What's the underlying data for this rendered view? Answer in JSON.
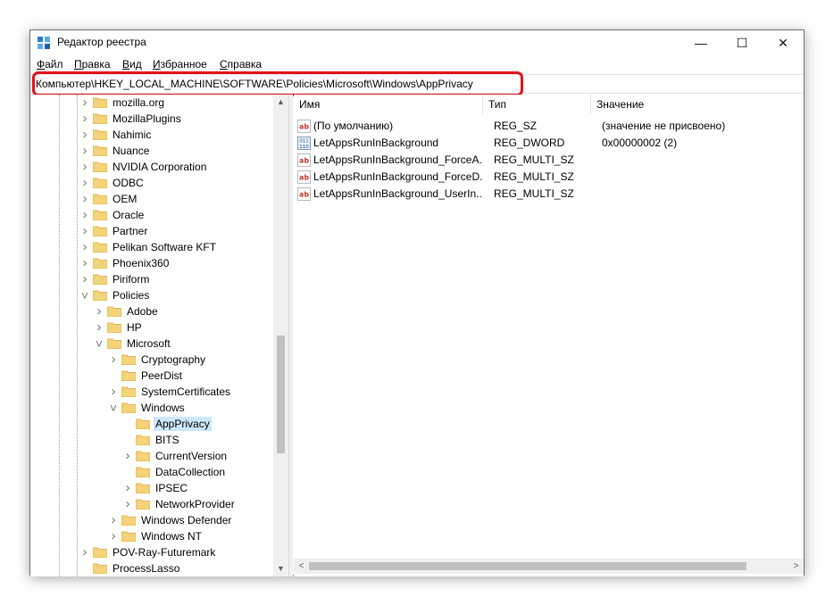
{
  "window": {
    "title": "Редактор реестра",
    "buttons": {
      "minimize": "—",
      "maximize": "☐",
      "close": "✕"
    }
  },
  "menu": {
    "items": [
      {
        "first": "Ф",
        "rest": "айл"
      },
      {
        "first": "П",
        "rest": "равка"
      },
      {
        "first": "В",
        "rest": "ид"
      },
      {
        "first": "И",
        "rest": "збранное"
      },
      {
        "first": "С",
        "rest": "правка"
      }
    ]
  },
  "address": {
    "path": "Компьютер\\HKEY_LOCAL_MACHINE\\SOFTWARE\\Policies\\Microsoft\\Windows\\AppPrivacy",
    "highlight_color": "#e2121b"
  },
  "tree": {
    "items": [
      {
        "label": "mozilla.org",
        "expander": "collapsed"
      },
      {
        "label": "MozillaPlugins",
        "expander": "collapsed"
      },
      {
        "label": "Nahimic",
        "expander": "collapsed"
      },
      {
        "label": "Nuance",
        "expander": "collapsed"
      },
      {
        "label": "NVIDIA Corporation",
        "expander": "collapsed"
      },
      {
        "label": "ODBC",
        "expander": "collapsed"
      },
      {
        "label": "OEM",
        "expander": "collapsed"
      },
      {
        "label": "Oracle",
        "expander": "collapsed"
      },
      {
        "label": "Partner",
        "expander": "collapsed"
      },
      {
        "label": "Pelikan Software KFT",
        "expander": "collapsed"
      },
      {
        "label": "Phoenix360",
        "expander": "collapsed"
      },
      {
        "label": "Piriform",
        "expander": "collapsed"
      },
      {
        "label": "Policies",
        "expander": "expanded"
      },
      {
        "label": "Adobe",
        "expander": "collapsed"
      },
      {
        "label": "HP",
        "expander": "collapsed"
      },
      {
        "label": "Microsoft",
        "expander": "expanded"
      },
      {
        "label": "Cryptography",
        "expander": "collapsed"
      },
      {
        "label": "PeerDist",
        "expander": "none"
      },
      {
        "label": "SystemCertificates",
        "expander": "collapsed"
      },
      {
        "label": "Windows",
        "expander": "expanded"
      },
      {
        "label": "AppPrivacy",
        "expander": "none",
        "selected": true
      },
      {
        "label": "BITS",
        "expander": "none"
      },
      {
        "label": "CurrentVersion",
        "expander": "collapsed"
      },
      {
        "label": "DataCollection",
        "expander": "none"
      },
      {
        "label": "IPSEC",
        "expander": "collapsed"
      },
      {
        "label": "NetworkProvider",
        "expander": "collapsed"
      },
      {
        "label": "Windows Defender",
        "expander": "collapsed"
      },
      {
        "label": "Windows NT",
        "expander": "collapsed"
      },
      {
        "label": "POV-Ray-Futuremark",
        "expander": "collapsed"
      },
      {
        "label": "ProcessLasso",
        "expander": "none"
      }
    ],
    "selected_bg": "#cce8ff",
    "folder_color": "#f5d37a"
  },
  "list": {
    "columns": {
      "name": "Имя",
      "type": "Тип",
      "data": "Значение"
    },
    "rows": [
      {
        "icon": "string-value-icon",
        "icon_text": "ab",
        "name": "(По умолчанию)",
        "type": "REG_SZ",
        "data": "(значение не присвоено)"
      },
      {
        "icon": "dword-value-icon",
        "icon_text": "011",
        "name": "LetAppsRunInBackground",
        "type": "REG_DWORD",
        "data": "0x00000002 (2)"
      },
      {
        "icon": "string-value-icon",
        "icon_text": "ab",
        "name": "LetAppsRunInBackground_ForceA...",
        "type": "REG_MULTI_SZ",
        "data": ""
      },
      {
        "icon": "string-value-icon",
        "icon_text": "ab",
        "name": "LetAppsRunInBackground_ForceD...",
        "type": "REG_MULTI_SZ",
        "data": ""
      },
      {
        "icon": "string-value-icon",
        "icon_text": "ab",
        "name": "LetAppsRunInBackground_UserIn...",
        "type": "REG_MULTI_SZ",
        "data": ""
      }
    ]
  },
  "scrollbars": {
    "left": "<",
    "right": ">",
    "up": "▲",
    "down": "▼"
  }
}
